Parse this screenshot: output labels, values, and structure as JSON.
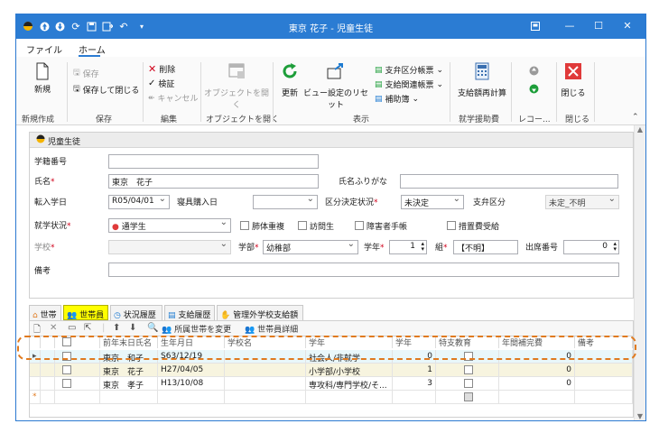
{
  "window": {
    "title": "東京 花子 - 児童生徒"
  },
  "menu": {
    "file": "ファイル",
    "home": "ホーム"
  },
  "ribbon": {
    "new": "新規",
    "group_new": "新規作成",
    "save": "保存",
    "save_close": "保存して閉じる",
    "group_save": "保存",
    "delete": "削除",
    "verify": "検証",
    "cancel": "キャンセル",
    "group_edit": "編集",
    "open_object": "オブジェクトを開く",
    "group_object": "オブジェクトを開く",
    "refresh": "更新",
    "view_reset": "ビュー設定のリセット",
    "report1": "支弁区分帳票",
    "report2": "支給関連帳票",
    "report3": "補助簿",
    "group_view": "表示",
    "recalc": "支給額再計算",
    "group_school": "就学援助費",
    "group_record": "レコー...",
    "close": "閉じる",
    "group_close": "閉じる"
  },
  "panel": {
    "title": "児童生徒",
    "labels": {
      "student_no": "学籍番号",
      "name": "氏名",
      "name_kana": "氏名ふりがな",
      "transfer_date": "転入学日",
      "dorm_date": "寝具購入日",
      "decision": "区分決定状況",
      "shiben": "支弁区分",
      "status": "就学状況",
      "tb": "肺体重複",
      "visit": "訪問生",
      "handicap": "障害者手帳",
      "measure": "措置費受給",
      "school": "学校",
      "dept": "学部",
      "grade": "学年",
      "class": "組",
      "attend_no": "出席番号",
      "note": "備考"
    },
    "values": {
      "student_no": "",
      "name": "東京　花子",
      "name_kana": "",
      "transfer_date": "R05/04/01",
      "dorm_date": "",
      "decision": "未決定",
      "shiben": "未定_不明",
      "status": "通学生",
      "school": "",
      "dept": "幼稚部",
      "grade": "1",
      "class": "【不明】",
      "attend_no": "0",
      "note": ""
    }
  },
  "tabs": [
    "世帯",
    "世帯員",
    "状況履歴",
    "支給履歴",
    "管理外学校支給額"
  ],
  "grid_toolbar": {
    "change_household": "所属世帯を変更",
    "member_detail": "世帯員詳細"
  },
  "grid": {
    "columns": [
      "",
      "前年末日氏名",
      "生年月日",
      "学校名",
      "学年",
      "学年",
      "特支教育",
      "年間補完費",
      "備考"
    ],
    "rows": [
      {
        "name": "東京　和子",
        "dob": "S63/12/19",
        "school": "",
        "grade_name": "社会人/非就学",
        "grade": "0",
        "amount": "0"
      },
      {
        "name": "東京　花子",
        "dob": "H27/04/05",
        "school": "",
        "grade_name": "小学部/小学校",
        "grade": "1",
        "amount": "0"
      },
      {
        "name": "東京　孝子",
        "dob": "H13/10/08",
        "school": "",
        "grade_name": "専攻科/専門学校/そ...",
        "grade": "3",
        "amount": "0"
      }
    ]
  },
  "colors": {
    "titlebar": "#2b7cd3",
    "highlight": "#e07a1f",
    "active_tab": "#ffff00"
  }
}
